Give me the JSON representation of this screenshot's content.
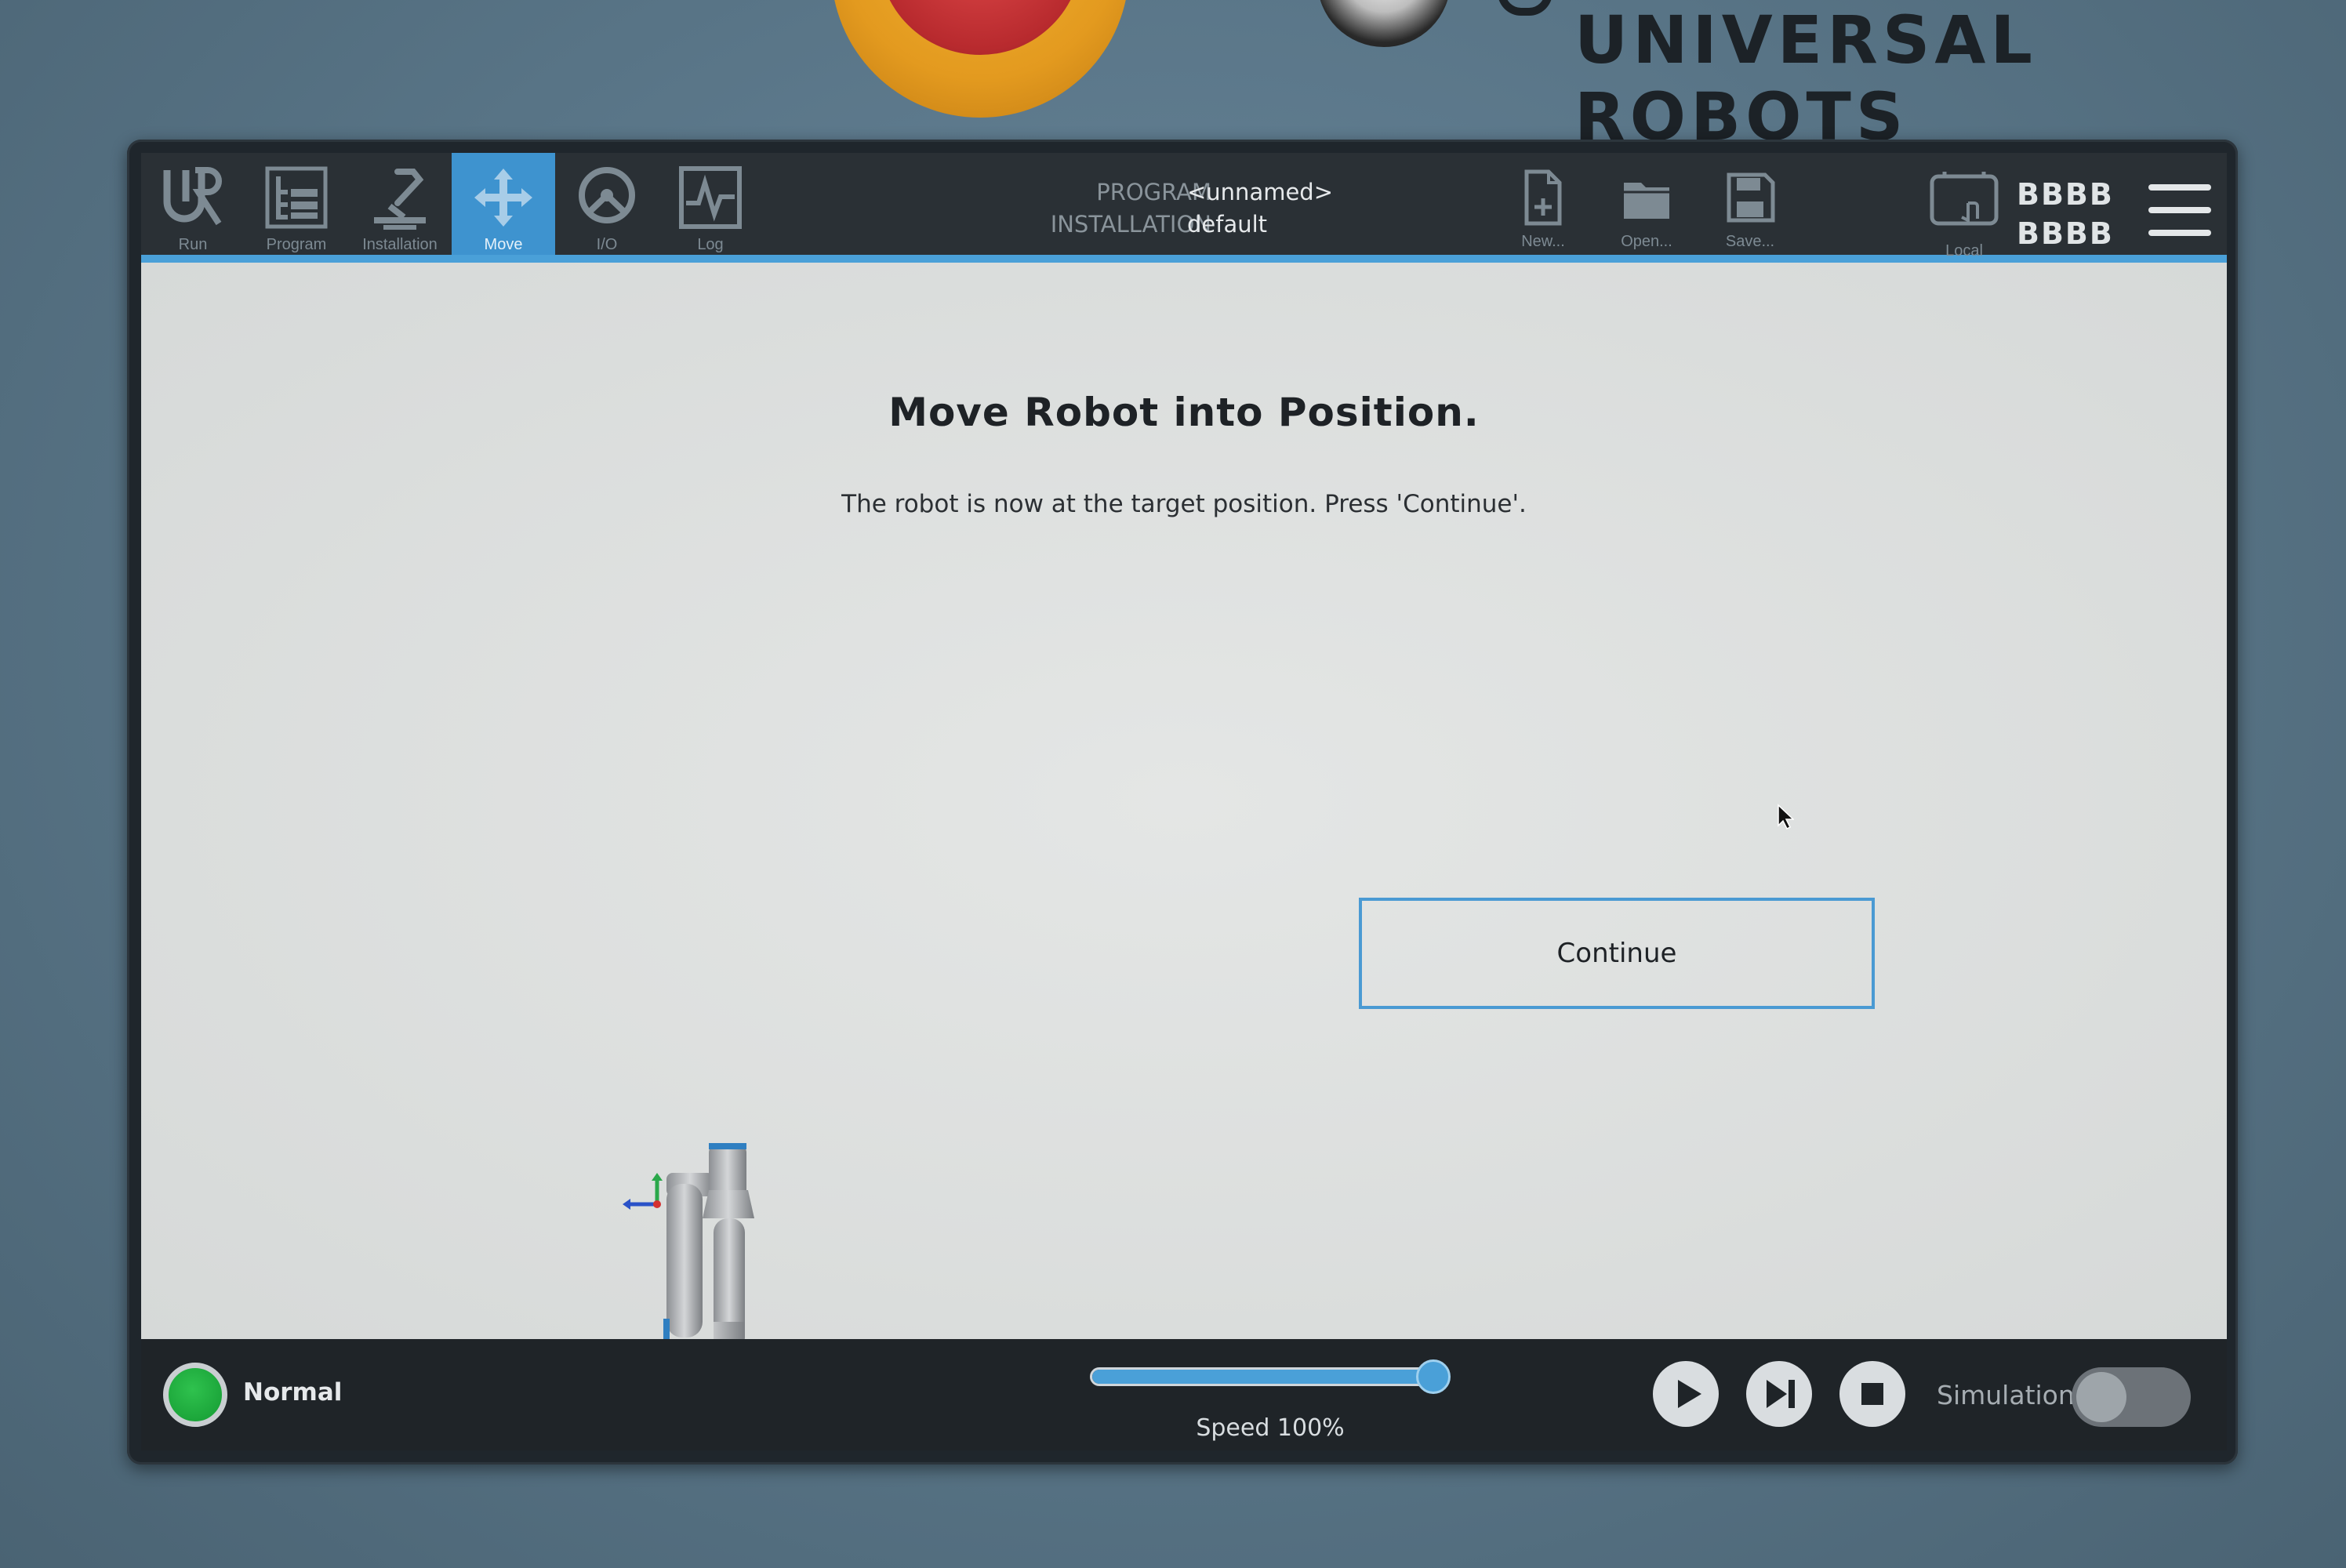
{
  "device": {
    "brand": "UNIVERSAL ROBOTS"
  },
  "topbar": {
    "nav": [
      {
        "label": "Run",
        "icon": "ur-logo-icon"
      },
      {
        "label": "Program",
        "icon": "program-icon"
      },
      {
        "label": "Installation",
        "icon": "installation-icon"
      },
      {
        "label": "Move",
        "icon": "move-icon",
        "active": true
      },
      {
        "label": "I/O",
        "icon": "io-icon"
      },
      {
        "label": "Log",
        "icon": "log-icon"
      }
    ],
    "program_label": "PROGRAM",
    "program_value": "<unnamed>",
    "installation_label": "INSTALLATION",
    "installation_value": "default",
    "file": {
      "new_label": "New...",
      "open_label": "Open...",
      "save_label": "Save..."
    },
    "local_label": "Local",
    "robot_id_line1": "BBBB",
    "robot_id_line2": "BBBB",
    "accent_color": "#4aa0d8"
  },
  "main": {
    "title": "Move Robot into Position.",
    "message": "The robot is now at the target position. Press 'Continue'.",
    "continue_label": "Continue"
  },
  "footer": {
    "status": "Normal",
    "status_color": "#1ea83c",
    "speed_label": "Speed 100%",
    "speed_percent": 100,
    "simulation_label": "Simulation",
    "simulation_on": false
  }
}
